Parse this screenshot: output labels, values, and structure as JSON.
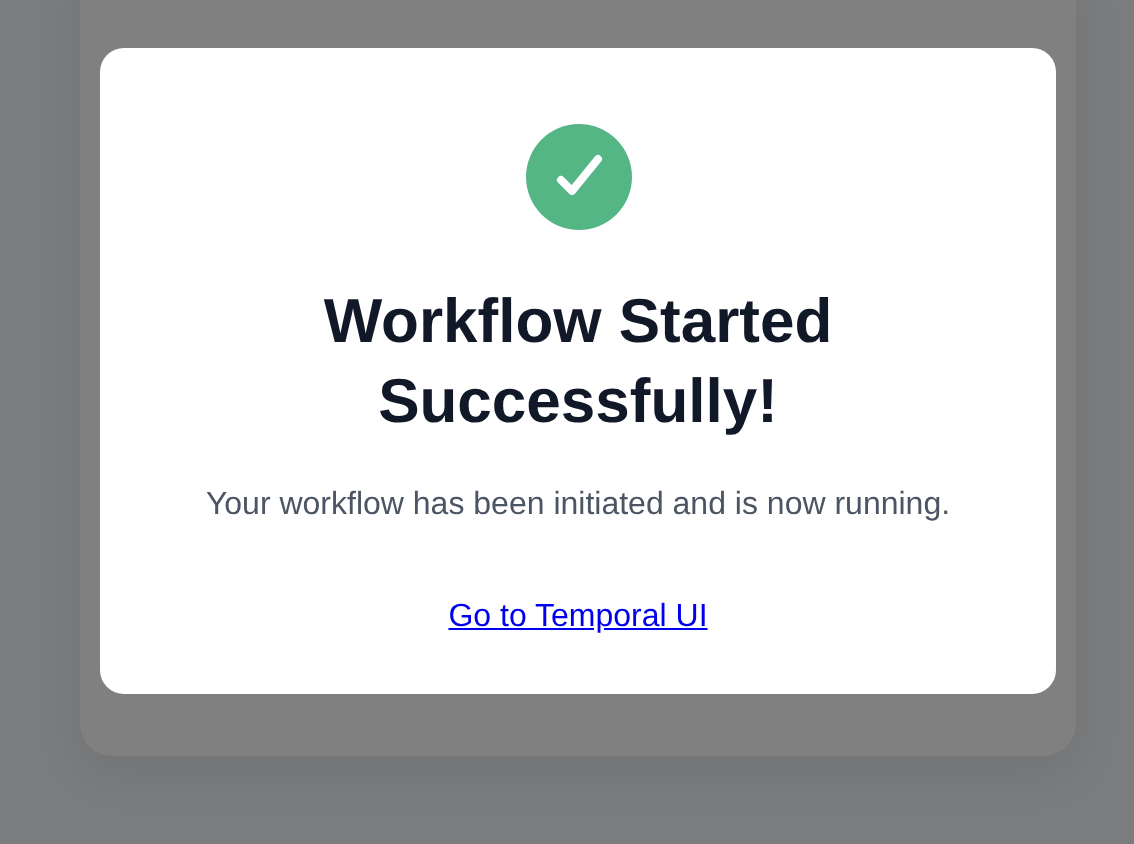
{
  "dialog": {
    "title": "Workflow Started Successfully!",
    "message": "Your workflow has been initiated and is now running.",
    "link": "Go to Temporal UI",
    "success": true
  }
}
